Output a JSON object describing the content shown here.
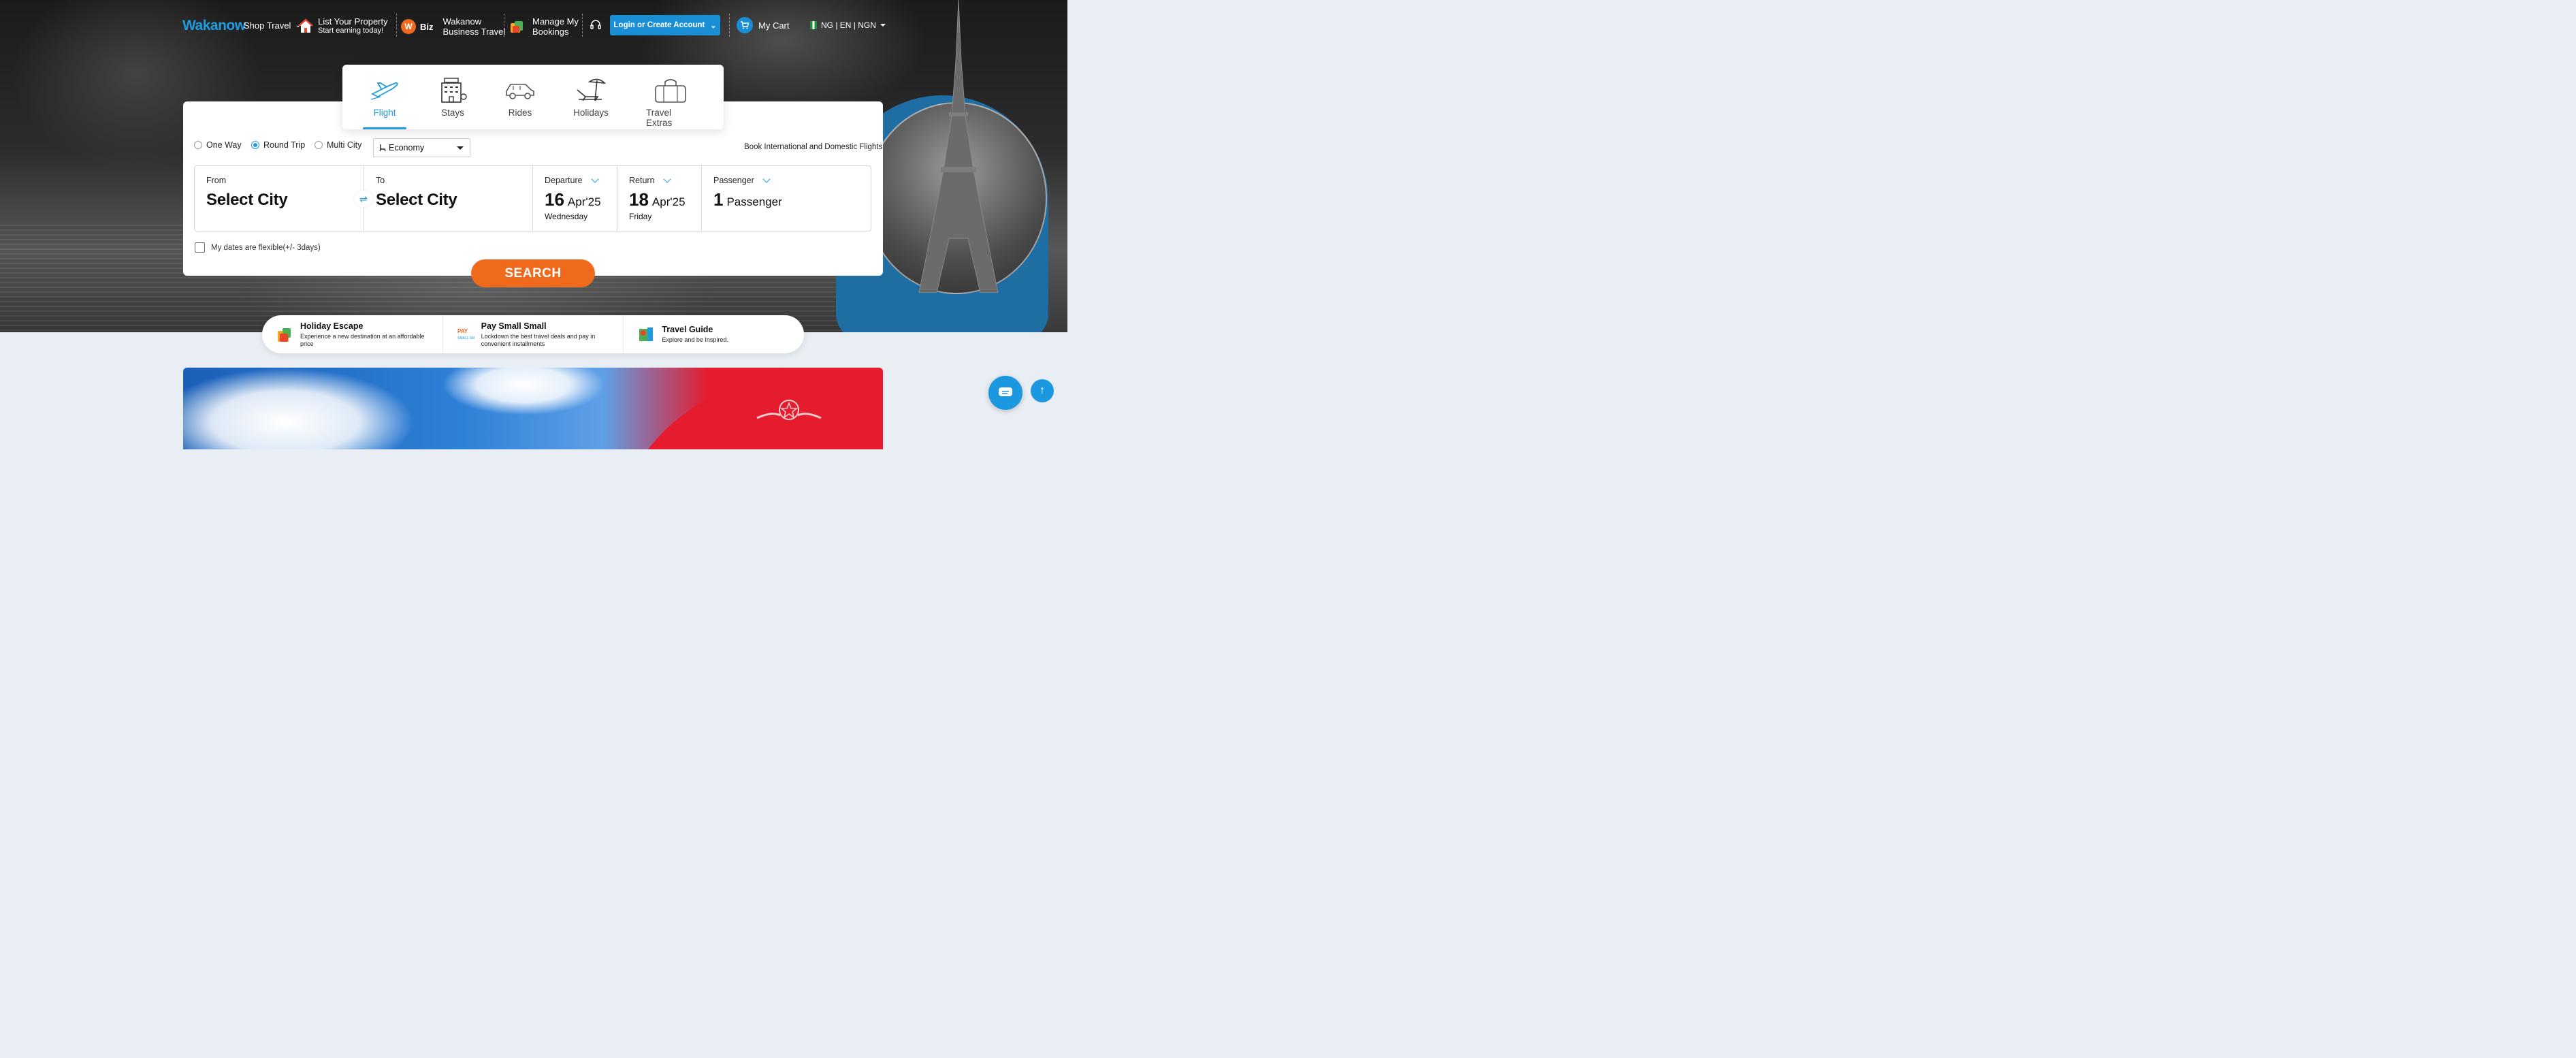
{
  "brand": {
    "logo_text": "Wakanow"
  },
  "nav": {
    "shop_travel": "Shop Travel",
    "list_property_title": "List Your Property",
    "list_property_sub": "Start earning today!",
    "biz_badge": "Biz",
    "business_title": "Wakanow",
    "business_sub": "Business Travel",
    "manage_title": "Manage My",
    "manage_sub": "Bookings",
    "login_label": "Login or Create Account",
    "cart_label": "My Cart",
    "locale": "NG | EN | NGN"
  },
  "tabs": [
    {
      "label": "Flight",
      "active": true
    },
    {
      "label": "Stays"
    },
    {
      "label": "Rides"
    },
    {
      "label": "Holidays"
    },
    {
      "label": "Travel Extras"
    }
  ],
  "trip_types": [
    {
      "label": "One Way",
      "selected": false
    },
    {
      "label": "Round Trip",
      "selected": true
    },
    {
      "label": "Multi City",
      "selected": false
    }
  ],
  "cabin": {
    "value": "Economy"
  },
  "book_note": "Book International and Domestic Flights",
  "fields": {
    "from": {
      "label": "From",
      "value": "Select City"
    },
    "to": {
      "label": "To",
      "value": "Select City"
    },
    "departure": {
      "label": "Departure",
      "day": "16",
      "month": "Apr'25",
      "weekday": "Wednesday"
    },
    "return": {
      "label": "Return",
      "day": "18",
      "month": "Apr'25",
      "weekday": "Friday"
    },
    "passenger": {
      "label": "Passenger",
      "count": "1",
      "unit": "Passenger"
    }
  },
  "flexible_label": "My dates are flexible(+/- 3days)",
  "search_label": "SEARCH",
  "features": [
    {
      "title": "Holiday Escape",
      "desc": "Experience a new destination at an affordable price"
    },
    {
      "title": "Pay Small Small",
      "desc": "Lockdown the best travel deals and pay in convenient installments"
    },
    {
      "title": "Travel Guide",
      "desc": "Explore and be Inspired."
    }
  ],
  "colors": {
    "brand_blue": "#1f9ce0",
    "button_blue": "#1b8fd6",
    "search_orange": "#f06a1d"
  }
}
